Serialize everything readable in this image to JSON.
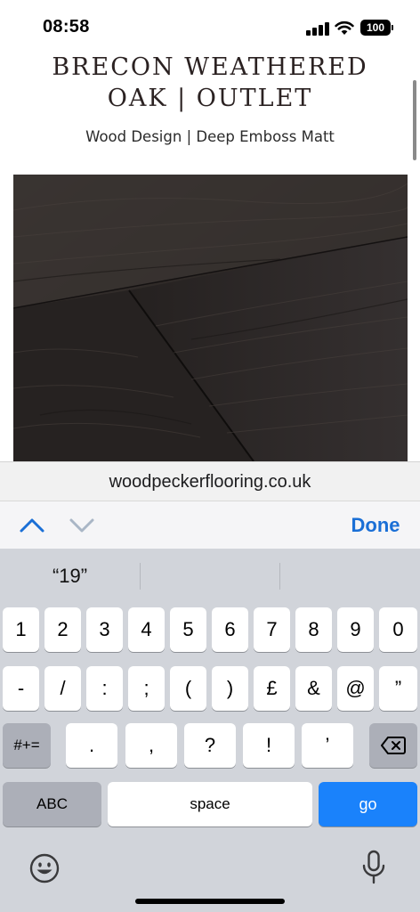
{
  "status_bar": {
    "time": "08:58",
    "battery": "100"
  },
  "product": {
    "title": "BRECON WEATHERED OAK | OUTLET",
    "subtitle": "Wood Design | Deep Emboss Matt"
  },
  "browser": {
    "url": "woodpeckerflooring.co.uk"
  },
  "form_accessory": {
    "done_label": "Done"
  },
  "keyboard": {
    "suggestions": [
      "“19”",
      "",
      ""
    ],
    "row1": [
      "1",
      "2",
      "3",
      "4",
      "5",
      "6",
      "7",
      "8",
      "9",
      "0"
    ],
    "row2": [
      "-",
      "/",
      ":",
      ";",
      "(",
      ")",
      "£",
      "&",
      "@",
      "”"
    ],
    "row3": [
      ".",
      ",",
      "?",
      "!",
      "’"
    ],
    "shift_label": "#+=",
    "abc_label": "ABC",
    "space_label": "space",
    "go_label": "go"
  },
  "colors": {
    "accent": "#1a6fd6",
    "go_key": "#1a82fb",
    "keyboard_bg": "#d1d4da"
  }
}
